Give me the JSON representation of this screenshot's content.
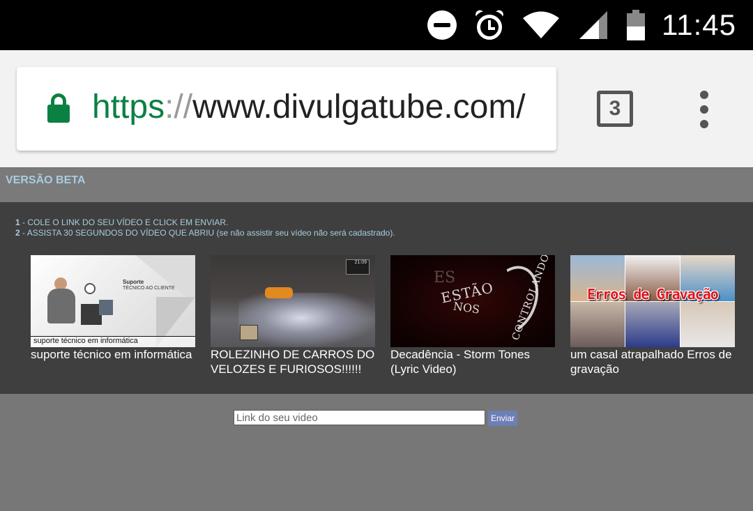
{
  "status_bar": {
    "time": "11:45",
    "icons": [
      "do-not-disturb-icon",
      "alarm-icon",
      "wifi-icon",
      "cell-signal-icon",
      "battery-icon"
    ]
  },
  "browser": {
    "url_scheme": "https",
    "url_separator": "://",
    "url_host": "www.divulgatube.com/",
    "tab_count": "3",
    "secure_color": "#0b8043"
  },
  "page": {
    "header": {
      "beta_label": "VERSÃO BETA"
    },
    "instructions": [
      {
        "number": "1",
        "text": " - COLE O LINK DO SEU VÍDEO E CLICK EM ENVIAR."
      },
      {
        "number": "2",
        "text": " - ASSISTA 30 SEGUNDOS DO VÍDEO QUE ABRIU (se não assistir seu vídeo não será cadastrado)."
      }
    ],
    "videos": [
      {
        "title": "suporte técnico em informática",
        "thumb_text": [
          "Suporte",
          "TÉCNICO AO CLIENTE",
          "suporte técnico em informática"
        ]
      },
      {
        "title": "ROLEZINHO DE CARROS DO VELOZES E FURIOSOS!!!!!!",
        "thumb_text": [
          "21:09"
        ]
      },
      {
        "title": "Decadência - Storm Tones (Lyric Video)",
        "thumb_text": [
          "ES",
          "ESTÃO",
          "NOS",
          "CONTROLANDO"
        ]
      },
      {
        "title": "um casal atrapalhado Erros de gravação",
        "thumb_text": [
          "Erros de Gravação"
        ]
      }
    ],
    "form": {
      "input_placeholder": "Link do seu video",
      "submit_label": "Enviar"
    },
    "colors": {
      "accent_text": "#a8cde0",
      "button": "#6d7fb5",
      "panel": "#3f3f3f",
      "background": "#777777"
    }
  }
}
